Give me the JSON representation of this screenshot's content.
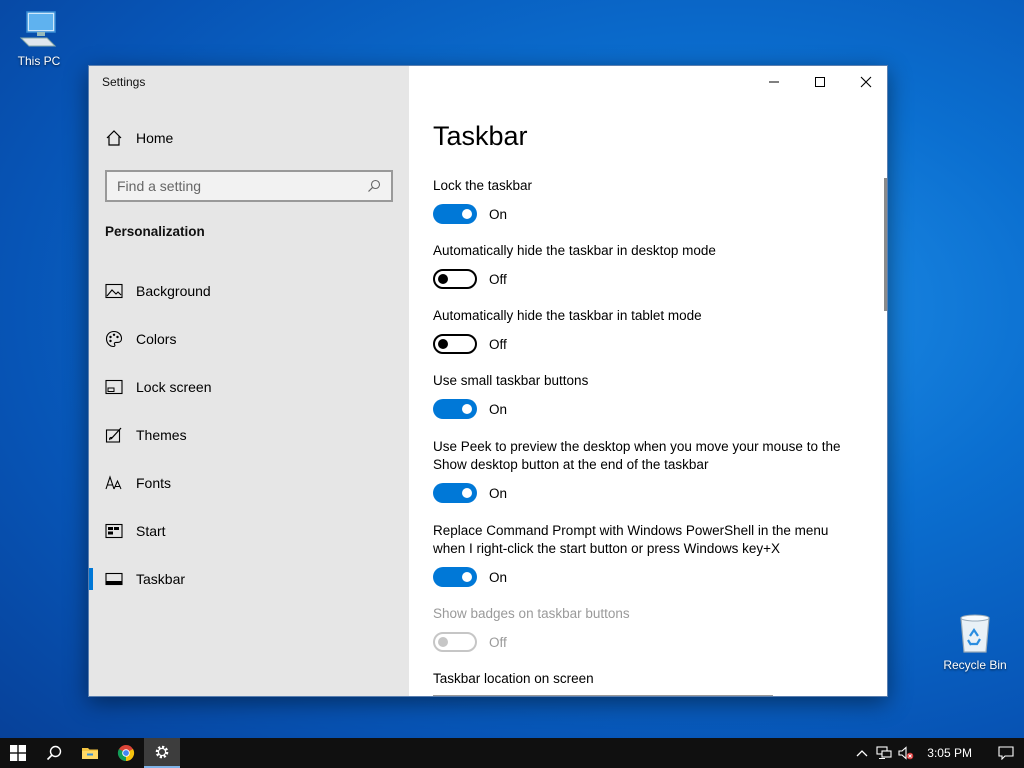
{
  "desktop": {
    "icons": [
      {
        "label": "This PC"
      },
      {
        "label": "Recycle Bin"
      }
    ]
  },
  "window": {
    "app_title": "Settings",
    "controls": {
      "minimize": "minimize-icon",
      "maximize": "maximize-icon",
      "close": "close-icon"
    }
  },
  "sidebar": {
    "home_label": "Home",
    "search_placeholder": "Find a setting",
    "section_title": "Personalization",
    "items": [
      {
        "label": "Background",
        "icon": "picture-icon"
      },
      {
        "label": "Colors",
        "icon": "palette-icon"
      },
      {
        "label": "Lock screen",
        "icon": "lock-screen-icon"
      },
      {
        "label": "Themes",
        "icon": "brush-icon"
      },
      {
        "label": "Fonts",
        "icon": "font-icon"
      },
      {
        "label": "Start",
        "icon": "start-icon"
      },
      {
        "label": "Taskbar",
        "icon": "taskbar-icon",
        "selected": true
      }
    ]
  },
  "main": {
    "title": "Taskbar",
    "settings": [
      {
        "label": "Lock the taskbar",
        "state": "On",
        "on": true
      },
      {
        "label": "Automatically hide the taskbar in desktop mode",
        "state": "Off",
        "on": false
      },
      {
        "label": "Automatically hide the taskbar in tablet mode",
        "state": "Off",
        "on": false
      },
      {
        "label": "Use small taskbar buttons",
        "state": "On",
        "on": true
      },
      {
        "label_line1": "Use Peek to preview the desktop when you move your mouse to the",
        "label_line2": "Show desktop button at the end of the taskbar",
        "state": "On",
        "on": true
      },
      {
        "label_line1": "Replace Command Prompt with Windows PowerShell in the menu",
        "label_line2": "when I right-click the start button or press Windows key+X",
        "state": "On",
        "on": true
      },
      {
        "label": "Show badges on taskbar buttons",
        "state": "Off",
        "on": false,
        "disabled": true
      }
    ],
    "location_label": "Taskbar location on screen"
  },
  "taskbar": {
    "clock": "3:05 PM",
    "apps": [
      "windows-start-icon",
      "search-icon",
      "file-explorer-icon",
      "chrome-icon",
      "settings-gear-icon"
    ]
  },
  "colors": {
    "accent": "#0078d7"
  }
}
